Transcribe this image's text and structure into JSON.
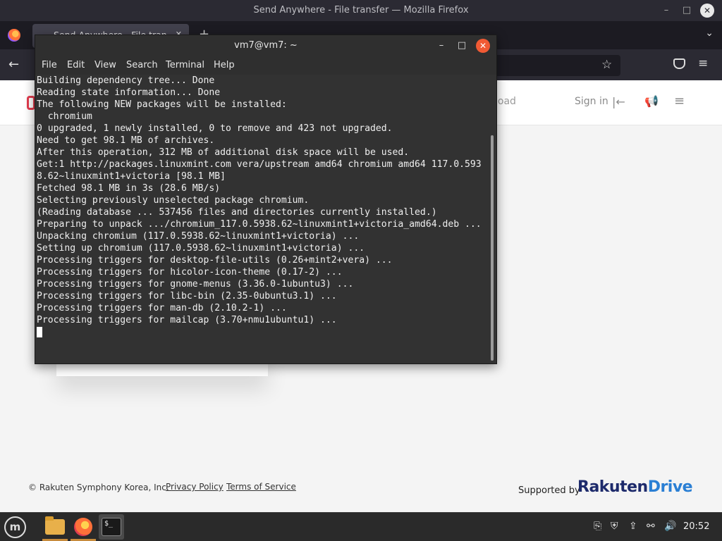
{
  "firefox": {
    "window_title": "Send Anywhere - File transfer — Mozilla Firefox",
    "tab_title": "Send Anywhere - File tran",
    "minimize_glyph": "–",
    "maximize_glyph": "□",
    "close_glyph": "✕",
    "tab_close_glyph": "✕",
    "new_tab_glyph": "+",
    "list_tabs_glyph": "⌄",
    "back_glyph": "←",
    "bookmark_glyph": "☆",
    "menu_glyph": "≡"
  },
  "page": {
    "header": {
      "download_partial": "load",
      "sign_in": "Sign in",
      "sign_in_glyph": "|←",
      "announce_glyph": "📢",
      "menu_glyph": "≡"
    },
    "footer": {
      "copyright": "© Rakuten Symphony Korea, Inc.",
      "privacy_policy": "Privacy Policy",
      "terms_of_service": "Terms of Service",
      "supported_by": "Supported by",
      "brand_part1": "Rakuten",
      "brand_part2": "Drive"
    }
  },
  "terminal": {
    "title": "vm7@vm7: ~",
    "minimize_glyph": "–",
    "maximize_glyph": "□",
    "close_glyph": "✕",
    "menu": [
      "File",
      "Edit",
      "View",
      "Search",
      "Terminal",
      "Help"
    ],
    "lines": [
      "Building dependency tree... Done",
      "Reading state information... Done",
      "The following NEW packages will be installed:",
      "  chromium",
      "0 upgraded, 1 newly installed, 0 to remove and 423 not upgraded.",
      "Need to get 98.1 MB of archives.",
      "After this operation, 312 MB of additional disk space will be used.",
      "Get:1 http://packages.linuxmint.com vera/upstream amd64 chromium amd64 117.0.593",
      "8.62~linuxmint1+victoria [98.1 MB]",
      "Fetched 98.1 MB in 3s (28.6 MB/s)",
      "Selecting previously unselected package chromium.",
      "(Reading database ... 537456 files and directories currently installed.)",
      "Preparing to unpack .../chromium_117.0.5938.62~linuxmint1+victoria_amd64.deb ...",
      "Unpacking chromium (117.0.5938.62~linuxmint1+victoria) ...",
      "Setting up chromium (117.0.5938.62~linuxmint1+victoria) ...",
      "Processing triggers for desktop-file-utils (0.26+mint2+vera) ...",
      "Processing triggers for hicolor-icon-theme (0.17-2) ...",
      "Processing triggers for gnome-menus (3.36.0-1ubuntu3) ...",
      "Processing triggers for libc-bin (2.35-0ubuntu3.1) ...",
      "Processing triggers for man-db (2.10.2-1) ...",
      "Processing triggers for mailcap (3.70+nmu1ubuntu1) ..."
    ]
  },
  "taskbar": {
    "menu_glyph": "m",
    "terminal_glyph": "$_",
    "clock": "20:52",
    "tray_icons": [
      "clipboard-icon",
      "shield-icon",
      "update-icon",
      "network-icon",
      "volume-icon"
    ],
    "tray_glyphs": [
      "⎘",
      "⛨",
      "⇪",
      "⚯",
      "🔊"
    ]
  },
  "colors": {
    "terminal_bg": "#323232",
    "terminal_close": "#f05a34",
    "firefox_chrome": "#2b2a33",
    "brand_dark": "#1d2a6b",
    "brand_blue": "#2a7fd4"
  }
}
